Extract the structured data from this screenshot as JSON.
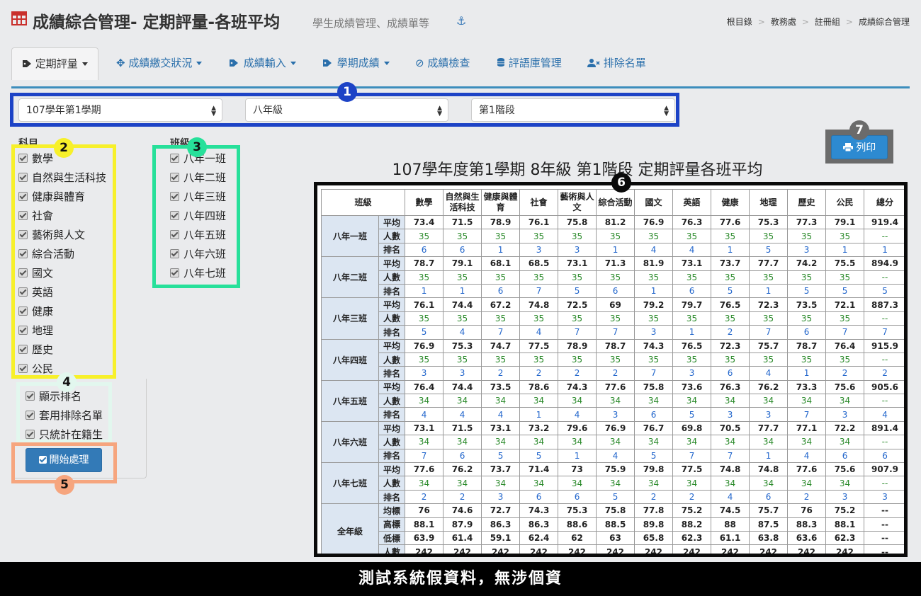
{
  "header": {
    "title": "成績綜合管理- 定期評量-各班平均",
    "subtitle": "學生成績管理、成績單等",
    "anchor_icon": "⚓",
    "breadcrumb": [
      "根目錄",
      "教務處",
      "註冊組",
      "成績綜合管理"
    ]
  },
  "tabs": [
    {
      "label": "定期評量",
      "icon": "tag-icon",
      "dropdown": true,
      "active": true
    },
    {
      "label": "成績繳交狀況",
      "icon": "crosshair-icon",
      "dropdown": true
    },
    {
      "label": "成績輸入",
      "icon": "tags-icon",
      "dropdown": true
    },
    {
      "label": "學期成績",
      "icon": "tags-icon",
      "dropdown": true
    },
    {
      "label": "成績檢查",
      "icon": "check-circle-icon",
      "dropdown": false
    },
    {
      "label": "評語庫管理",
      "icon": "database-icon",
      "dropdown": false
    },
    {
      "label": "排除名單",
      "icon": "user-times-icon",
      "dropdown": false
    }
  ],
  "filters": {
    "semester": "107學年第1學期",
    "grade": "八年級",
    "stage": "第1階段"
  },
  "subjects_label": "科目",
  "classes_label": "班級",
  "subjects": [
    "數學",
    "自然與生活科技",
    "健康與體育",
    "社會",
    "藝術與人文",
    "綜合活動",
    "國文",
    "英語",
    "健康",
    "地理",
    "歷史",
    "公民"
  ],
  "classes": [
    "八年一班",
    "八年二班",
    "八年三班",
    "八年四班",
    "八年五班",
    "八年六班",
    "八年七班"
  ],
  "options": [
    "顯示排名",
    "套用排除名單",
    "只統計在籍生"
  ],
  "start_button": "開始處理",
  "print_button": "列印",
  "badges": [
    "1",
    "2",
    "3",
    "4",
    "5",
    "6",
    "7"
  ],
  "report_title": "107學年度第1學期 8年級 第1階段 定期評量各班平均",
  "table": {
    "header_class": "班級",
    "columns": [
      "數學",
      "自然與生活科技",
      "健康與體育",
      "社會",
      "藝術與人文",
      "綜合活動",
      "國文",
      "英語",
      "健康",
      "地理",
      "歷史",
      "公民",
      "總分"
    ],
    "metric_labels": [
      "平均",
      "人數",
      "排名"
    ],
    "groups": [
      {
        "name": "八年一班",
        "avg": [
          "73.4",
          "71.5",
          "78.9",
          "76.1",
          "75.8",
          "81.2",
          "76.9",
          "76.3",
          "77.6",
          "75.3",
          "77.3",
          "79.1",
          "919.4"
        ],
        "count": [
          "35",
          "35",
          "35",
          "35",
          "35",
          "35",
          "35",
          "35",
          "35",
          "35",
          "35",
          "35",
          "--"
        ],
        "rank": [
          "6",
          "6",
          "1",
          "3",
          "3",
          "1",
          "4",
          "4",
          "1",
          "5",
          "3",
          "1",
          "1"
        ]
      },
      {
        "name": "八年二班",
        "avg": [
          "78.7",
          "79.1",
          "68.1",
          "68.5",
          "73.1",
          "71.3",
          "81.9",
          "73.1",
          "73.7",
          "77.7",
          "74.2",
          "75.5",
          "894.9"
        ],
        "count": [
          "35",
          "35",
          "35",
          "35",
          "35",
          "35",
          "35",
          "35",
          "35",
          "35",
          "35",
          "35",
          "--"
        ],
        "rank": [
          "1",
          "1",
          "6",
          "7",
          "5",
          "6",
          "1",
          "6",
          "5",
          "1",
          "5",
          "5",
          "5"
        ]
      },
      {
        "name": "八年三班",
        "avg": [
          "76.1",
          "74.4",
          "67.2",
          "74.8",
          "72.5",
          "69",
          "79.2",
          "79.7",
          "76.5",
          "72.3",
          "73.5",
          "72.1",
          "887.3"
        ],
        "count": [
          "35",
          "35",
          "35",
          "35",
          "35",
          "35",
          "35",
          "35",
          "35",
          "35",
          "35",
          "35",
          "--"
        ],
        "rank": [
          "5",
          "4",
          "7",
          "4",
          "7",
          "7",
          "3",
          "1",
          "2",
          "7",
          "6",
          "7",
          "7"
        ]
      },
      {
        "name": "八年四班",
        "avg": [
          "76.9",
          "75.3",
          "74.7",
          "77.5",
          "78.9",
          "78.7",
          "74.3",
          "76.5",
          "72.3",
          "75.7",
          "78.7",
          "76.4",
          "915.9"
        ],
        "count": [
          "35",
          "35",
          "35",
          "35",
          "35",
          "35",
          "35",
          "35",
          "35",
          "35",
          "35",
          "35",
          "--"
        ],
        "rank": [
          "3",
          "3",
          "2",
          "2",
          "2",
          "2",
          "7",
          "3",
          "6",
          "4",
          "1",
          "2",
          "2"
        ]
      },
      {
        "name": "八年五班",
        "avg": [
          "76.4",
          "74.4",
          "73.5",
          "78.6",
          "74.3",
          "77.6",
          "75.8",
          "73.6",
          "76.3",
          "76.2",
          "73.3",
          "75.6",
          "905.6"
        ],
        "count": [
          "34",
          "34",
          "34",
          "34",
          "34",
          "34",
          "34",
          "34",
          "34",
          "34",
          "34",
          "34",
          "--"
        ],
        "rank": [
          "4",
          "4",
          "4",
          "1",
          "4",
          "3",
          "6",
          "5",
          "3",
          "3",
          "7",
          "3",
          "4"
        ]
      },
      {
        "name": "八年六班",
        "avg": [
          "73.1",
          "71.5",
          "73.1",
          "73.2",
          "79.6",
          "76.9",
          "76.7",
          "69.8",
          "70.5",
          "77.7",
          "77.1",
          "72.2",
          "891.4"
        ],
        "count": [
          "34",
          "34",
          "34",
          "34",
          "34",
          "34",
          "34",
          "34",
          "34",
          "34",
          "34",
          "34",
          "--"
        ],
        "rank": [
          "7",
          "6",
          "5",
          "5",
          "1",
          "4",
          "5",
          "7",
          "7",
          "1",
          "4",
          "6",
          "6"
        ]
      },
      {
        "name": "八年七班",
        "avg": [
          "77.6",
          "76.2",
          "73.7",
          "71.4",
          "73",
          "75.9",
          "79.8",
          "77.5",
          "74.8",
          "74.8",
          "77.6",
          "75.6",
          "907.9"
        ],
        "count": [
          "34",
          "34",
          "34",
          "34",
          "34",
          "34",
          "34",
          "34",
          "34",
          "34",
          "34",
          "34",
          "--"
        ],
        "rank": [
          "2",
          "2",
          "3",
          "6",
          "6",
          "5",
          "2",
          "2",
          "4",
          "6",
          "2",
          "3",
          "3"
        ]
      }
    ],
    "summary": {
      "name": "全年級",
      "labels": [
        "均標",
        "高標",
        "低標",
        "人數"
      ],
      "rows": [
        [
          "76",
          "74.6",
          "72.7",
          "74.3",
          "75.3",
          "75.8",
          "77.8",
          "75.2",
          "74.5",
          "75.7",
          "76",
          "75.2",
          "--"
        ],
        [
          "88.1",
          "87.9",
          "86.3",
          "86.3",
          "88.6",
          "88.5",
          "89.8",
          "88.2",
          "88",
          "87.5",
          "88.3",
          "88.1",
          "--"
        ],
        [
          "63.9",
          "61.4",
          "59.1",
          "62.4",
          "62",
          "63",
          "65.8",
          "62.3",
          "61.1",
          "63.8",
          "63.6",
          "62.3",
          "--"
        ],
        [
          "242",
          "242",
          "242",
          "242",
          "242",
          "242",
          "242",
          "242",
          "242",
          "242",
          "242",
          "242",
          "--"
        ]
      ]
    }
  },
  "footer_text": "測試系統假資料，無涉個資",
  "colors": {
    "primary": "#337ab7",
    "box_blue": "#1d43c6",
    "box_yellow": "#f7f02a",
    "box_green": "#27e09a",
    "box_orange": "#f6a57e",
    "count_green": "#2a8a2a",
    "rank_blue": "#2266cc"
  }
}
